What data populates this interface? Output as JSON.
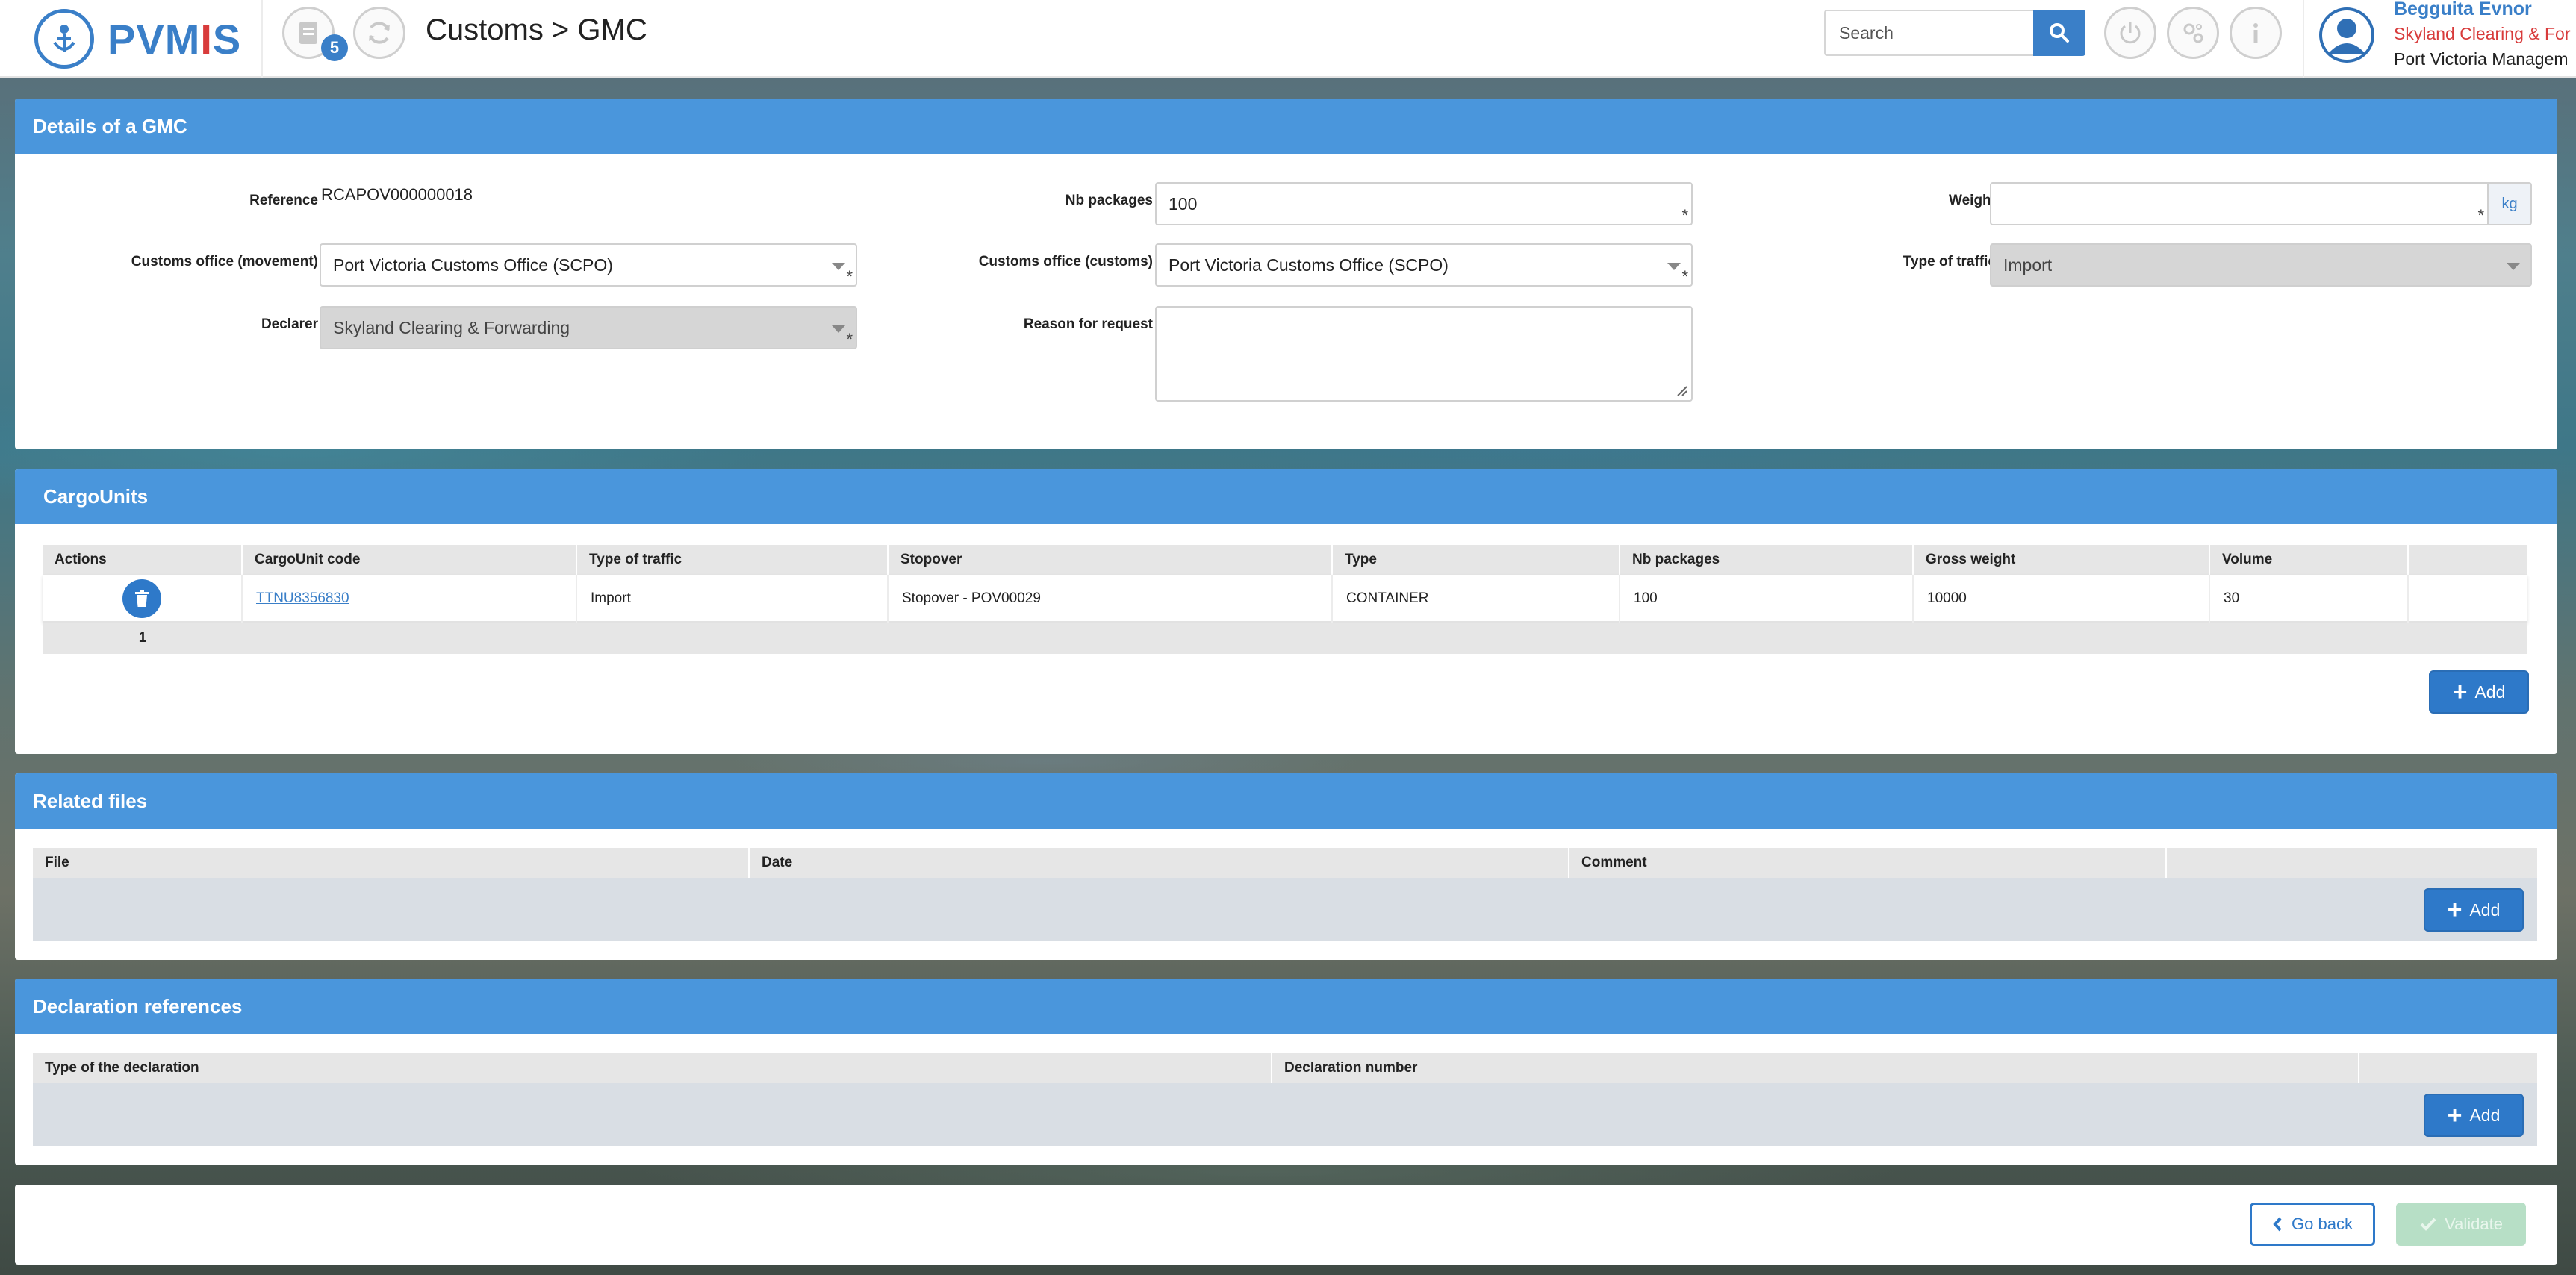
{
  "header": {
    "logo_text_a": "PVM",
    "logo_text_b": "I",
    "logo_text_c": "S",
    "notifications_count": "5",
    "breadcrumb": "Customs > GMC",
    "search_placeholder": "Search",
    "user_name": "Begguita Evnor",
    "user_company": "Skyland Clearing & For",
    "user_org": "Port Victoria Managem"
  },
  "details": {
    "title": "Details of a GMC",
    "reference_label": "Reference",
    "reference_value": "RCAPOV000000018",
    "nb_packages_label": "Nb packages",
    "nb_packages_value": "100",
    "weight_label": "Weight",
    "weight_value": "",
    "weight_unit": "kg",
    "office_movement_label": "Customs office (movement)",
    "office_movement_value": "Port Victoria Customs Office (SCPO)",
    "office_customs_label": "Customs office (customs)",
    "office_customs_value": "Port Victoria Customs Office (SCPO)",
    "traffic_label": "Type of traffic",
    "traffic_value": "Import",
    "declarer_label": "Declarer",
    "declarer_value": "Skyland Clearing & Forwarding",
    "reason_label": "Reason for request",
    "reason_value": "",
    "required_mark": "*"
  },
  "cargo": {
    "title": "CargoUnits",
    "columns": [
      "Actions",
      "CargoUnit code",
      "Type of traffic",
      "Stopover",
      "Type",
      "Nb packages",
      "Gross weight",
      "Volume",
      ""
    ],
    "rows": [
      {
        "code": "TTNU8356830",
        "traffic": "Import",
        "stopover": "Stopover - POV00029",
        "type": "CONTAINER",
        "packages": "100",
        "gross_weight": "10000",
        "volume": "30"
      }
    ],
    "page": "1",
    "add_label": "Add"
  },
  "files": {
    "title": "Related files",
    "columns": [
      "File",
      "Date",
      "Comment",
      ""
    ],
    "add_label": "Add"
  },
  "declarations": {
    "title": "Declaration references",
    "columns": [
      "Type of the declaration",
      "Declaration number",
      ""
    ],
    "add_label": "Add"
  },
  "footer": {
    "go_back_label": "Go back",
    "validate_label": "Validate"
  },
  "colors": {
    "primary": "#3a7fc8",
    "panel_header": "#4a96dc",
    "brand_red": "#d83b3b",
    "validate_disabled": "#b7dfc6"
  },
  "icons": [
    "home-icon",
    "document-icon",
    "refresh-icon",
    "search-icon",
    "power-icon",
    "settings-icon",
    "info-icon",
    "user-avatar-icon",
    "trash-icon",
    "plus-icon",
    "chevron-left-icon",
    "check-icon",
    "resize-icon"
  ]
}
